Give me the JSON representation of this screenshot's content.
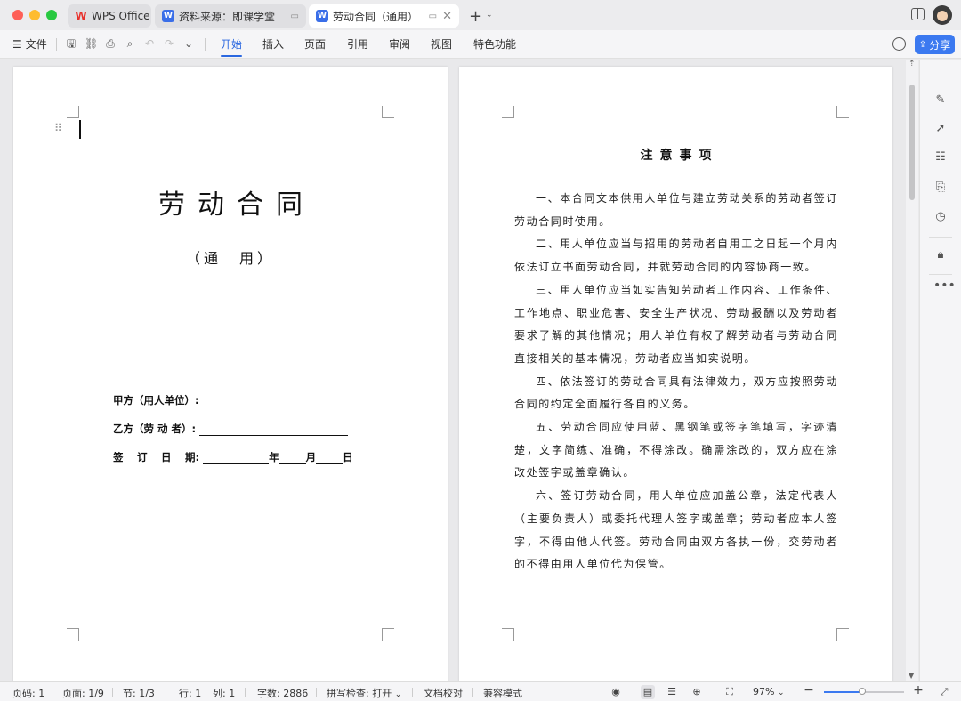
{
  "titlebar": {
    "tabs": [
      {
        "icon": "wps-logo-icon",
        "label": "WPS Office"
      },
      {
        "icon": "w-doc-icon",
        "label": "资料来源：即课学堂"
      },
      {
        "icon": "w-doc-icon",
        "label": "劳动合同（通用）"
      }
    ]
  },
  "toolbar": {
    "file_label": "文件",
    "ribbon_tabs": [
      "开始",
      "插入",
      "页面",
      "引用",
      "审阅",
      "视图",
      "特色功能"
    ],
    "active_tab": "开始",
    "share_label": "分享"
  },
  "page1": {
    "title": "劳动合同",
    "subtitle": "（通　用）",
    "party_a_label": "甲方（用人单位）:",
    "party_b_label": "乙方（劳 动 者）:",
    "sign_date_label": "签　 订　 日　 期:",
    "year": "年",
    "month": "月",
    "day": "日"
  },
  "page2": {
    "title": "注意事项",
    "paragraphs": [
      "一、本合同文本供用人单位与建立劳动关系的劳动者签订劳动合同时使用。",
      "二、用人单位应当与招用的劳动者自用工之日起一个月内依法订立书面劳动合同，并就劳动合同的内容协商一致。",
      "三、用人单位应当如实告知劳动者工作内容、工作条件、工作地点、职业危害、安全生产状况、劳动报酬以及劳动者要求了解的其他情况；用人单位有权了解劳动者与劳动合同直接相关的基本情况，劳动者应当如实说明。",
      "四、依法签订的劳动合同具有法律效力，双方应按照劳动合同的约定全面履行各自的义务。",
      "五、劳动合同应使用蓝、黑钢笔或签字笔填写，字迹清楚，文字简练、准确，不得涂改。确需涂改的，双方应在涂改处签字或盖章确认。",
      "六、签订劳动合同，用人单位应加盖公章，法定代表人（主要负责人）或委托代理人签字或盖章；劳动者应本人签字，不得由他人代签。劳动合同由双方各执一份，交劳动者的不得由用人单位代为保管。"
    ]
  },
  "statusbar": {
    "page_code": "页码: 1",
    "page": "页面: 1/9",
    "section": "节: 1/3",
    "row": "行: 1",
    "col": "列: 1",
    "word_count": "字数: 2886",
    "spell_check": "拼写检查: 打开",
    "proofread": "文档校对",
    "compat_mode": "兼容模式",
    "zoom": "97%",
    "zoom_fraction": 0.48
  },
  "colors": {
    "accent": "#3b79f0",
    "active_tab": "#2b68e0",
    "wps_red": "#e8302b"
  }
}
